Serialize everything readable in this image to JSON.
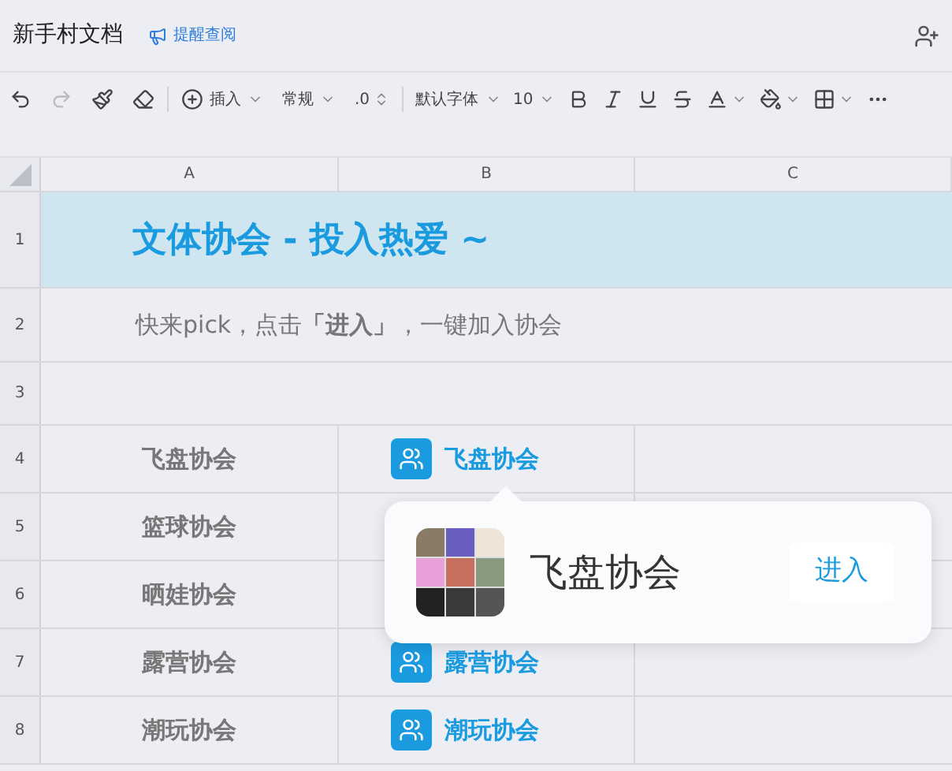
{
  "header": {
    "title": "新手村文档",
    "remind": "提醒查阅"
  },
  "toolbar": {
    "groups": [
      [
        {
          "kind": "undo",
          "disabled": false
        },
        {
          "kind": "redo",
          "disabled": true
        },
        {
          "kind": "format_painter",
          "disabled": false
        },
        {
          "kind": "eraser",
          "disabled": false
        }
      ],
      [
        {
          "kind": "insert",
          "label": "插入"
        },
        {
          "kind": "dropdown",
          "label": "常规"
        },
        {
          "kind": "stepper",
          "label": ".0"
        }
      ],
      [
        {
          "kind": "dropdown",
          "label": "默认字体"
        },
        {
          "kind": "dropdown",
          "label": "10"
        },
        {
          "kind": "bold"
        },
        {
          "kind": "italic"
        },
        {
          "kind": "underline"
        },
        {
          "kind": "strike"
        },
        {
          "kind": "font_color"
        },
        {
          "kind": "fill"
        },
        {
          "kind": "border"
        },
        {
          "kind": "more"
        }
      ]
    ]
  },
  "sheet": {
    "columns": [
      "A",
      "B",
      "C"
    ],
    "title_row": {
      "number": "1",
      "text": "文体协会 - 投入热爱 ~"
    },
    "intro_row": {
      "number": "2",
      "text": "快来pick，点击**「进入」**，一键加入协会"
    },
    "empty_row": {
      "number": "3"
    },
    "rows": [
      {
        "number": "4",
        "col_a": "飞盘协会",
        "col_b": "飞盘协会"
      },
      {
        "number": "5",
        "col_a": "篮球协会"
      },
      {
        "number": "6",
        "col_a": "晒娃协会"
      },
      {
        "number": "7",
        "col_a": "露营协会",
        "col_b": "露营协会"
      },
      {
        "number": "8",
        "col_a": "潮玩协会",
        "col_b": "潮玩协会"
      }
    ]
  },
  "popup": {
    "name": "飞盘协会",
    "button": "进入"
  }
}
